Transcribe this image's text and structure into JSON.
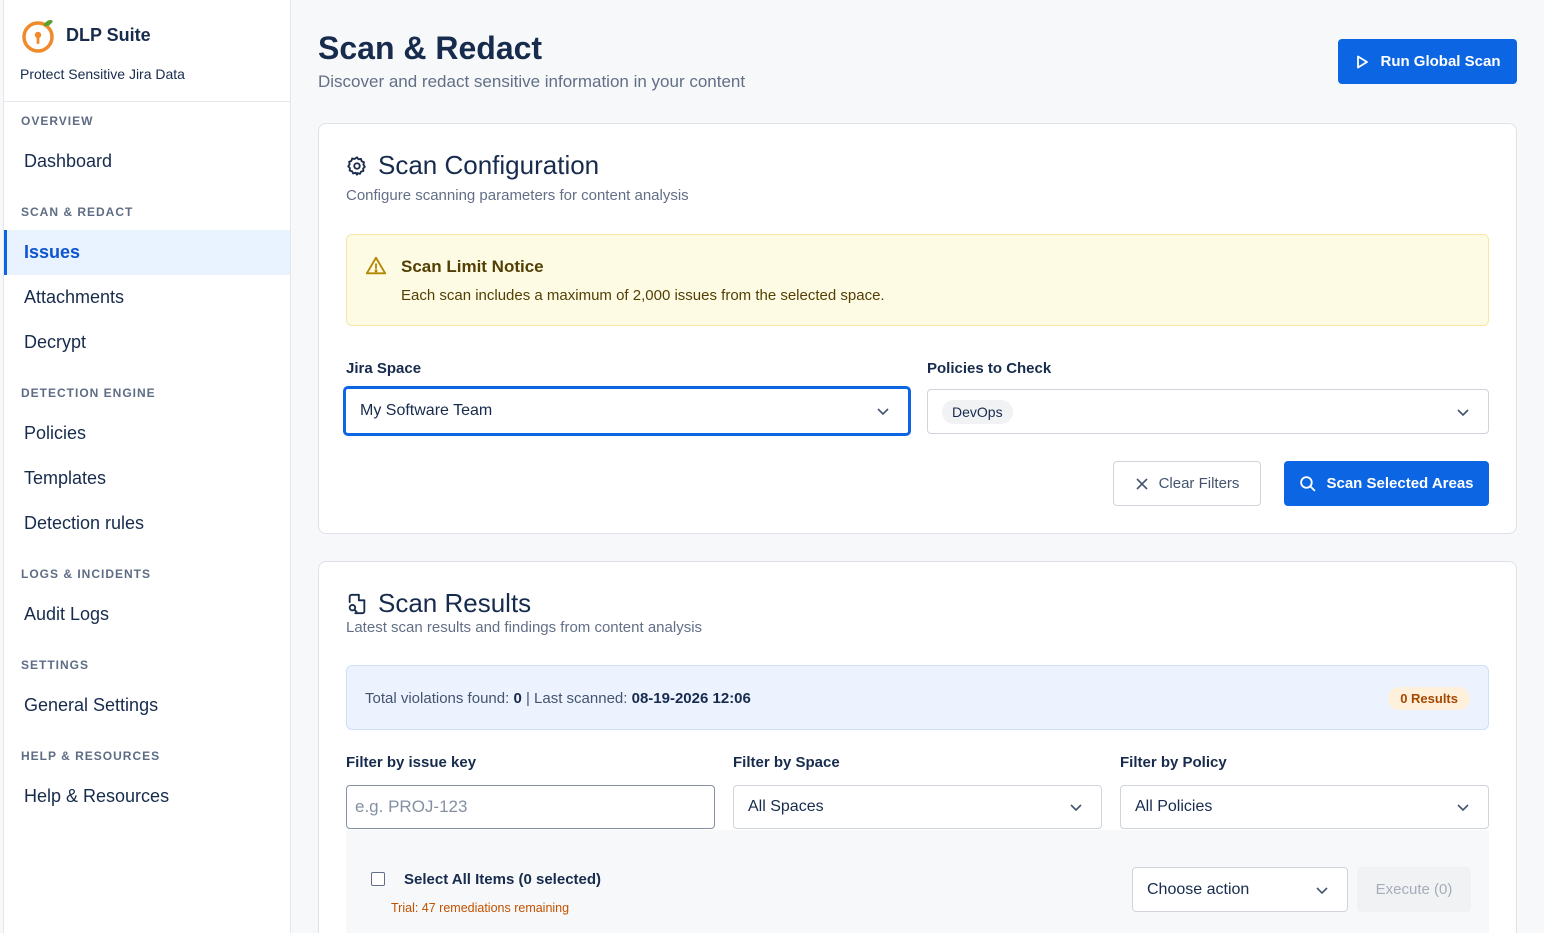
{
  "brand": {
    "name": "DLP Suite",
    "tagline": "Protect Sensitive Jira Data"
  },
  "nav": [
    {
      "section": "OVERVIEW",
      "items": [
        "Dashboard"
      ]
    },
    {
      "section": "SCAN & REDACT",
      "items": [
        "Issues",
        "Attachments",
        "Decrypt"
      ]
    },
    {
      "section": "DETECTION ENGINE",
      "items": [
        "Policies",
        "Templates",
        "Detection rules"
      ]
    },
    {
      "section": "LOGS & INCIDENTS",
      "items": [
        "Audit Logs"
      ]
    },
    {
      "section": "SETTINGS",
      "items": [
        "General Settings"
      ]
    },
    {
      "section": "HELP & RESOURCES",
      "items": [
        "Help & Resources"
      ]
    }
  ],
  "active_nav": "Issues",
  "header": {
    "title": "Scan & Redact",
    "subtitle": "Discover and redact sensitive information in your content",
    "global_scan_label": "Run Global Scan"
  },
  "config": {
    "title": "Scan Configuration",
    "subtitle": "Configure scanning parameters for content analysis",
    "notice_title": "Scan Limit Notice",
    "notice_text": "Each scan includes a maximum of 2,000 issues from the selected space.",
    "space_label": "Jira Space",
    "space_value": "My Software Team",
    "policies_label": "Policies to Check",
    "policies_tags": [
      "DevOps"
    ],
    "clear_label": "Clear Filters",
    "scan_label": "Scan Selected Areas"
  },
  "results": {
    "title": "Scan Results",
    "subtitle": "Latest scan results and findings from content analysis",
    "violations_label": "Total violations found:",
    "violations_value": "0",
    "separator": "|",
    "last_scanned_label": "Last scanned:",
    "last_scanned_value": "08-19-2026 12:06",
    "results_badge": "0 Results",
    "filter_issue_label": "Filter by issue key",
    "filter_issue_placeholder": "e.g. PROJ-123",
    "filter_space_label": "Filter by Space",
    "filter_space_value": "All Spaces",
    "filter_policy_label": "Filter by Policy",
    "filter_policy_value": "All Policies",
    "select_all_label": "Select All Items (0 selected)",
    "trial_text": "Trial: 47 remediations remaining",
    "action_placeholder": "Choose action",
    "execute_label": "Execute (0)"
  }
}
